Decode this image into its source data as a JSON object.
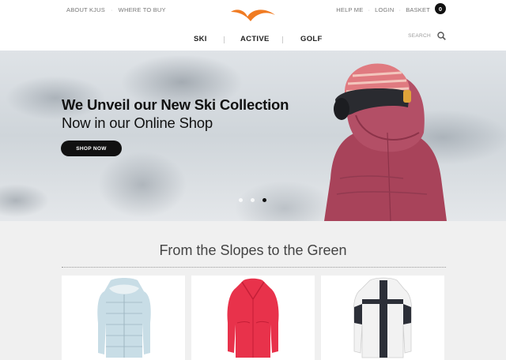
{
  "header": {
    "util_left": [
      "ABOUT KJUS",
      "WHERE TO BUY"
    ],
    "util_right": [
      "HELP ME",
      "LOGIN",
      "BASKET"
    ],
    "basket_count": "0",
    "logo_color": "#f07b22",
    "nav": [
      "SKI",
      "ACTIVE",
      "GOLF"
    ],
    "search_label": "SEARCH"
  },
  "hero": {
    "title": "We Unveil our New Ski Collection",
    "subtitle": "Now in our Online Shop",
    "button": "SHOP NOW",
    "slides": 3,
    "active_slide": 3
  },
  "section": {
    "title": "From the Slopes to the Green",
    "products": [
      {
        "name": "light-blue-down-jacket",
        "color": "#c8dde6"
      },
      {
        "name": "red-ski-jacket",
        "color": "#e8324b"
      },
      {
        "name": "white-black-ski-jacket",
        "color": "#f2f2f2"
      }
    ]
  }
}
